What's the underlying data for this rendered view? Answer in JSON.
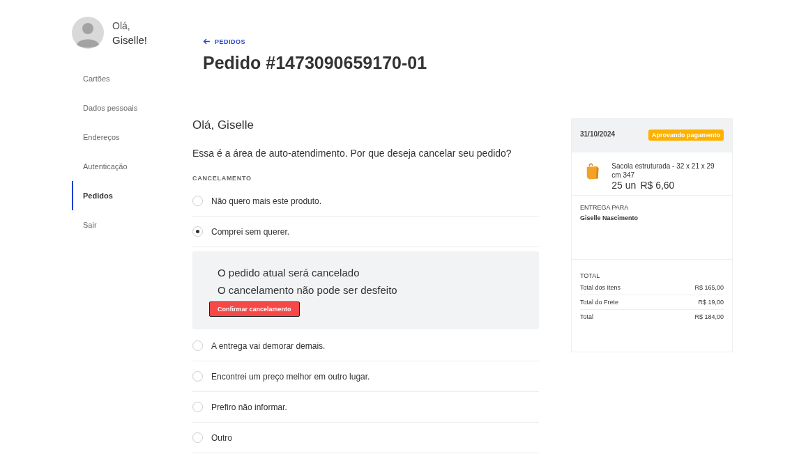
{
  "user": {
    "greeting": "Olá,",
    "name": "Giselle!"
  },
  "sidebar": {
    "items": [
      {
        "label": "Cartões",
        "selected": false
      },
      {
        "label": "Dados pessoais",
        "selected": false
      },
      {
        "label": "Endereços",
        "selected": false
      },
      {
        "label": "Autenticação",
        "selected": false
      },
      {
        "label": "Pedidos",
        "selected": true
      },
      {
        "label": "Sair",
        "selected": false
      }
    ]
  },
  "back_link": "PEDIDOS",
  "title": "Pedido #1473090659170-01",
  "greeting": "Olá, Giselle",
  "question": "Essa é a área de auto-atendimento. Por que deseja cancelar seu pedido?",
  "section_label": "CANCELAMENTO",
  "reasons": [
    {
      "label": "Não quero mais este produto.",
      "selected": false
    },
    {
      "label": "Comprei sem querer.",
      "selected": true
    },
    {
      "label": "A entrega vai demorar demais.",
      "selected": false
    },
    {
      "label": "Encontrei um preço melhor em outro lugar.",
      "selected": false
    },
    {
      "label": "Prefiro não informar.",
      "selected": false
    },
    {
      "label": "Outro",
      "selected": false
    }
  ],
  "confirmation": {
    "lines": [
      "O pedido atual será cancelado",
      "O cancelamento não pode ser desfeito"
    ],
    "button": "Confirmar cancelamento"
  },
  "order_card": {
    "date": "31/10/2024",
    "status": "Aprovando pagamento",
    "item": {
      "name": "Sacola estruturada - 32 x 21 x 29 cm 347",
      "quantity": "25 un",
      "price": "R$ 6,60"
    },
    "delivery_label": "ENTREGA PARA",
    "recipient": "Giselle Nascimento",
    "total_label": "TOTAL",
    "totals": [
      {
        "label": "Total dos Itens",
        "value": "R$ 165,00"
      },
      {
        "label": "Total do Frete",
        "value": "R$ 19,00"
      },
      {
        "label": "Total",
        "value": "R$ 184,00"
      }
    ]
  }
}
